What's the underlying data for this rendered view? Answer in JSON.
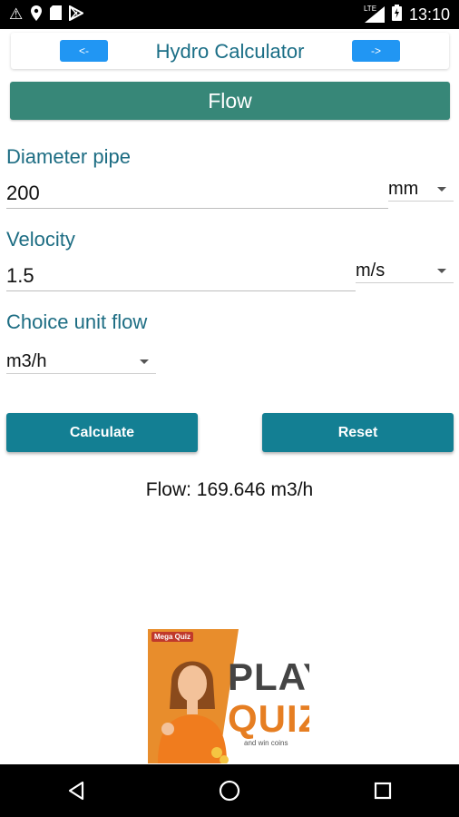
{
  "status_bar": {
    "time": "13:10",
    "network_label": "LTE"
  },
  "header": {
    "back_label": "<-",
    "title": "Hydro Calculator",
    "forward_label": "->"
  },
  "section_title": "Flow",
  "diameter": {
    "label": "Diameter pipe",
    "value": "200",
    "unit": "mm"
  },
  "velocity": {
    "label": "Velocity",
    "value": "1.5",
    "unit": "m/s"
  },
  "flow_unit": {
    "label": "Choice unit flow",
    "value": "m3/h"
  },
  "buttons": {
    "calculate": "Calculate",
    "reset": "Reset"
  },
  "result": "Flow: 169.646 m3/h",
  "ad": {
    "brand": "Mega Quiz",
    "line1": "PLAY",
    "line2": "QUIZ",
    "tagline": "and win coins"
  },
  "colors": {
    "accent": "#1d6d83",
    "banner": "#378778",
    "button": "#137f93",
    "nav_button": "#2196f3"
  }
}
